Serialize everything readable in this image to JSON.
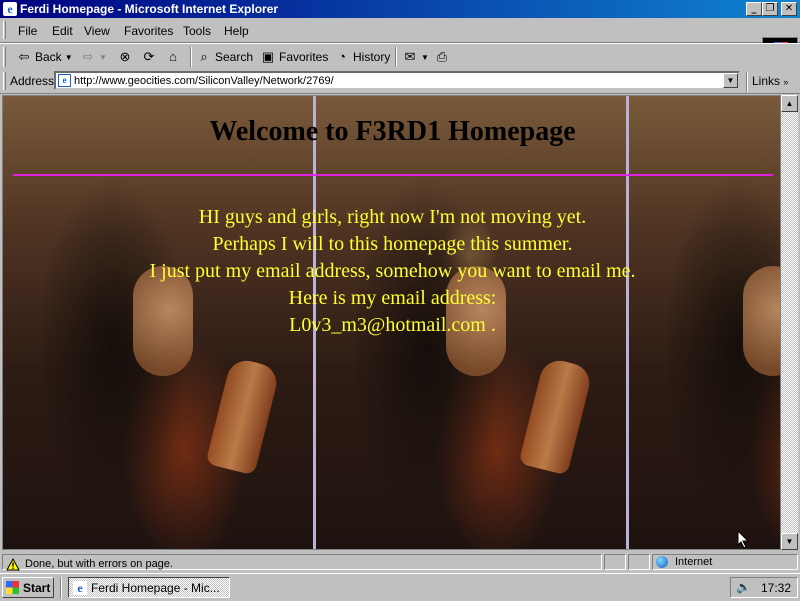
{
  "window": {
    "title": "Ferdi Homepage - Microsoft Internet Explorer"
  },
  "menu": {
    "items": [
      "File",
      "Edit",
      "View",
      "Favorites",
      "Tools",
      "Help"
    ]
  },
  "toolbar": {
    "back": "Back",
    "search": "Search",
    "favorites": "Favorites",
    "history": "History"
  },
  "address": {
    "label": "Address",
    "url": "http://www.geocities.com/SiliconValley/Network/2769/",
    "links_label": "Links"
  },
  "page": {
    "heading": "Welcome to F3RD1 Homepage",
    "message_lines": [
      "HI guys and girls, right now I'm not moving yet.",
      "Perhaps I will to this homepage this summer.",
      "I just put my email address, somehow you want to email me.",
      "Here is my email address:",
      "L0v3_m3@hotmail.com ."
    ],
    "heading_color": "#000000",
    "text_color": "#ffff33",
    "rule_color": "#e020e0"
  },
  "status": {
    "text": "Done, but with errors on page.",
    "zone": "Internet"
  },
  "taskbar": {
    "start": "Start",
    "task": "Ferdi Homepage - Mic...",
    "clock": "17:32"
  },
  "icons": [
    "ie-icon",
    "back-arrow-icon",
    "forward-arrow-icon",
    "stop-icon",
    "refresh-icon",
    "home-icon",
    "search-icon",
    "favorites-icon",
    "history-icon",
    "mail-icon",
    "print-icon",
    "warning-icon",
    "globe-icon",
    "speaker-icon",
    "windows-flag-icon",
    "cursor-icon"
  ]
}
